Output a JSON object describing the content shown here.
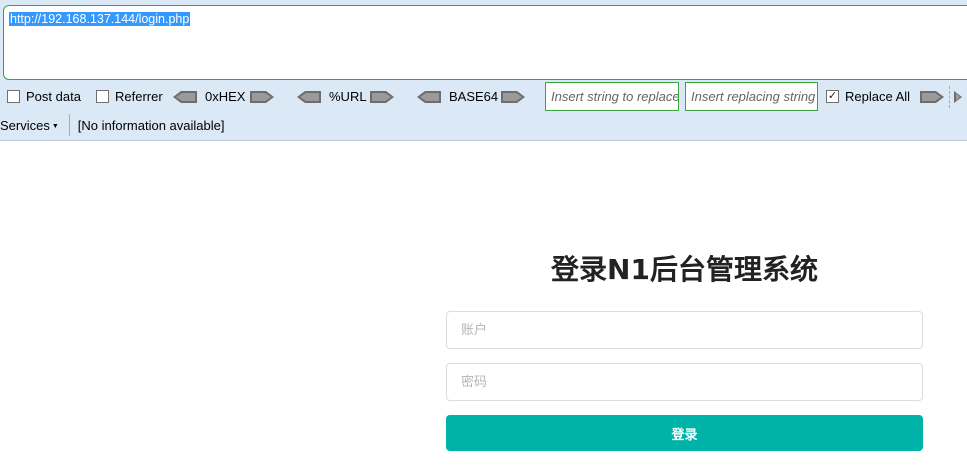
{
  "url_bar": {
    "value": "http://192.168.137.144/login.php"
  },
  "hackbar": {
    "post_data_label": "Post data",
    "referrer_label": "Referrer",
    "hex_label": "0xHEX",
    "url_label": "%URL",
    "base64_label": "BASE64",
    "replace_string_placeholder": "Insert string to replace",
    "replacing_string_placeholder": "Insert replacing string",
    "replace_all_label": "Replace All",
    "replace_all_checked": "✓"
  },
  "status_bar": {
    "services_label": "Services",
    "info_text": "[No information available]"
  },
  "login": {
    "title": "登录N1后台管理系统",
    "account_placeholder": "账户",
    "password_placeholder": "密码",
    "submit_label": "登录"
  },
  "colors": {
    "toolbar_bg": "#dbe8f6",
    "accent_green": "#3aa53a",
    "selection": "#3399ff",
    "login_button": "#00b3a9"
  }
}
